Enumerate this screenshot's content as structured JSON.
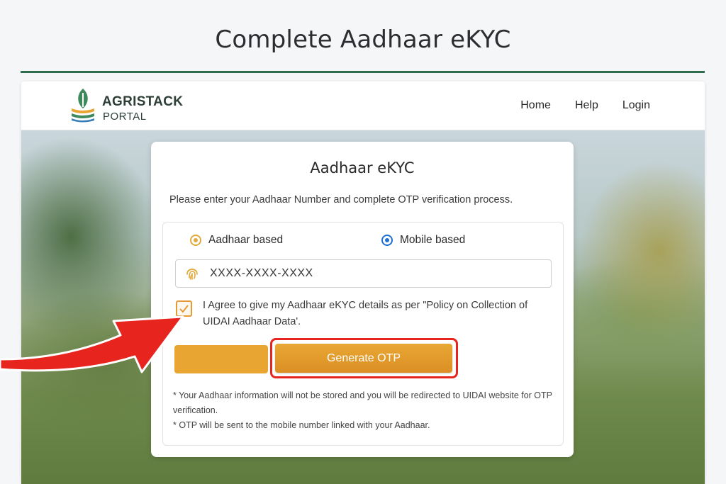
{
  "page_heading": "Complete Aadhaar eKYC",
  "navbar": {
    "brand_title": "AGRISTACK",
    "brand_subtitle": "PORTAL",
    "links": [
      "Home",
      "Help",
      "Login"
    ]
  },
  "card": {
    "title": "Aadhaar eKYC",
    "description": "Please enter your Aadhaar Number and complete OTP verification process.",
    "radio_options": [
      "Aadhaar based",
      "Mobile based"
    ],
    "selected_option": "Mobile based",
    "aadhaar_input_value": "XXXX-XXXX-XXXX",
    "consent_checked": true,
    "consent_text": "I Agree to give my Aadhaar eKYC details as per \"Policy on Collection of UIDAI Aadhaar Data'.",
    "generate_otp_label": "Generate OTP",
    "notes": [
      "* Your Aadhaar information will not be stored and you will be redirected to UIDAI website for OTP verification.",
      "* OTP will be sent to the mobile number linked with your Aadhaar."
    ]
  },
  "colors": {
    "accent": "#e9a531",
    "highlight": "#e8241f",
    "radio_selected": "#1e6fd6",
    "heading_rule": "#2f6b4f"
  }
}
